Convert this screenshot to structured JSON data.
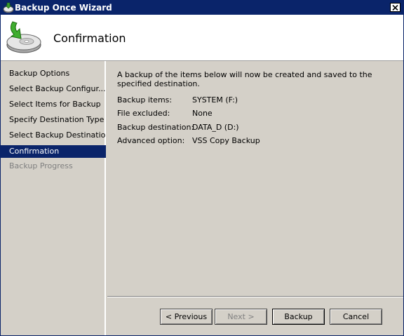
{
  "window": {
    "title": "Backup Once Wizard"
  },
  "header": {
    "title": "Confirmation"
  },
  "sidebar": {
    "items": [
      {
        "label": "Backup Options",
        "state": "normal"
      },
      {
        "label": "Select Backup Configur...",
        "state": "normal"
      },
      {
        "label": "Select Items for Backup",
        "state": "normal"
      },
      {
        "label": "Specify Destination Type",
        "state": "normal"
      },
      {
        "label": "Select Backup Destination",
        "state": "normal"
      },
      {
        "label": "Confirmation",
        "state": "selected"
      },
      {
        "label": "Backup Progress",
        "state": "disabled"
      }
    ]
  },
  "main": {
    "intro": "A backup of the items below will now be created and saved to the specified destination.",
    "details": [
      {
        "label": "Backup items:",
        "value": "SYSTEM (F:)"
      },
      {
        "label": "File excluded:",
        "value": "None"
      },
      {
        "label": "Backup destination:",
        "value": "DATA_D (D:)"
      },
      {
        "label": "Advanced option:",
        "value": "VSS Copy Backup"
      }
    ]
  },
  "footer": {
    "previous_label": "< Previous",
    "next_label": "Next >",
    "backup_label": "Backup",
    "cancel_label": "Cancel"
  },
  "colors": {
    "title_bar": "#0a246a",
    "selected_item": "#0a246a",
    "panel_bg": "#d4d0c8",
    "header_bg": "#ffffff"
  },
  "icons": {
    "title": "backup-wizard-icon",
    "header": "disk-backup-icon",
    "close": "close-icon"
  }
}
